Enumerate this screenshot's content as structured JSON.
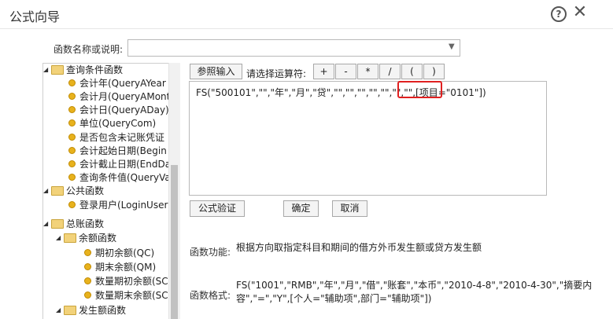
{
  "dialog": {
    "title": "公式向导",
    "help_glyph": "?",
    "close_glyph": "✕"
  },
  "function_name": {
    "label": "函数名称或说明:",
    "value": ""
  },
  "tree": {
    "items": [
      {
        "label": "查询条件函数",
        "type": "folder"
      },
      {
        "label": "会计年(QueryAYear",
        "type": "leaf"
      },
      {
        "label": "会计月(QueryAMont",
        "type": "leaf"
      },
      {
        "label": "会计日(QueryADay)",
        "type": "leaf"
      },
      {
        "label": "单位(QueryCom)",
        "type": "leaf"
      },
      {
        "label": "是否包含未记账凭证",
        "type": "leaf"
      },
      {
        "label": "会计起始日期(Begin",
        "type": "leaf"
      },
      {
        "label": "会计截止日期(EndDa",
        "type": "leaf"
      },
      {
        "label": "查询条件值(QueryVa",
        "type": "leaf"
      },
      {
        "label": "公共函数",
        "type": "folder"
      },
      {
        "label": "登录用户(LoginUser",
        "type": "leaf"
      },
      {
        "label": "总账函数",
        "type": "folder"
      },
      {
        "label": "余额函数",
        "type": "folder"
      },
      {
        "label": "期初余额(QC)",
        "type": "leaf"
      },
      {
        "label": "期末余额(QM)",
        "type": "leaf"
      },
      {
        "label": "数量期初余额(SC",
        "type": "leaf"
      },
      {
        "label": "数量期末余额(SC",
        "type": "leaf"
      },
      {
        "label": "发生额函数",
        "type": "folder"
      }
    ]
  },
  "toolbar": {
    "ref_input_label": "参照输入",
    "operator_label": "请选择运算符:",
    "operators": [
      "+",
      "-",
      "*",
      "/",
      "(",
      ")"
    ]
  },
  "editor": {
    "formula": "FS(\"500101\",\"\",\"年\",\"月\",\"贷\",\"\",\"\",\"\",\"\",\"\",\"\",\"\",[项目=\"0101\"])"
  },
  "actions": {
    "validate_label": "公式验证",
    "ok_label": "确定",
    "cancel_label": "取消"
  },
  "info": {
    "function_desc_label": "函数功能:",
    "function_desc": "根据方向取指定科目和期间的借方外币发生额或贷方发生额",
    "format_label": "函数格式:",
    "format_text": "FS(\"1001\",\"RMB\",\"年\",\"月\",\"借\",\"账套\",\"本币\",\"2010-4-8\",\"2010-4-30\",\"摘要内容\",\"=\",\"Y\",[个人=\"辅助项\",部门=\"辅助项\"])"
  }
}
